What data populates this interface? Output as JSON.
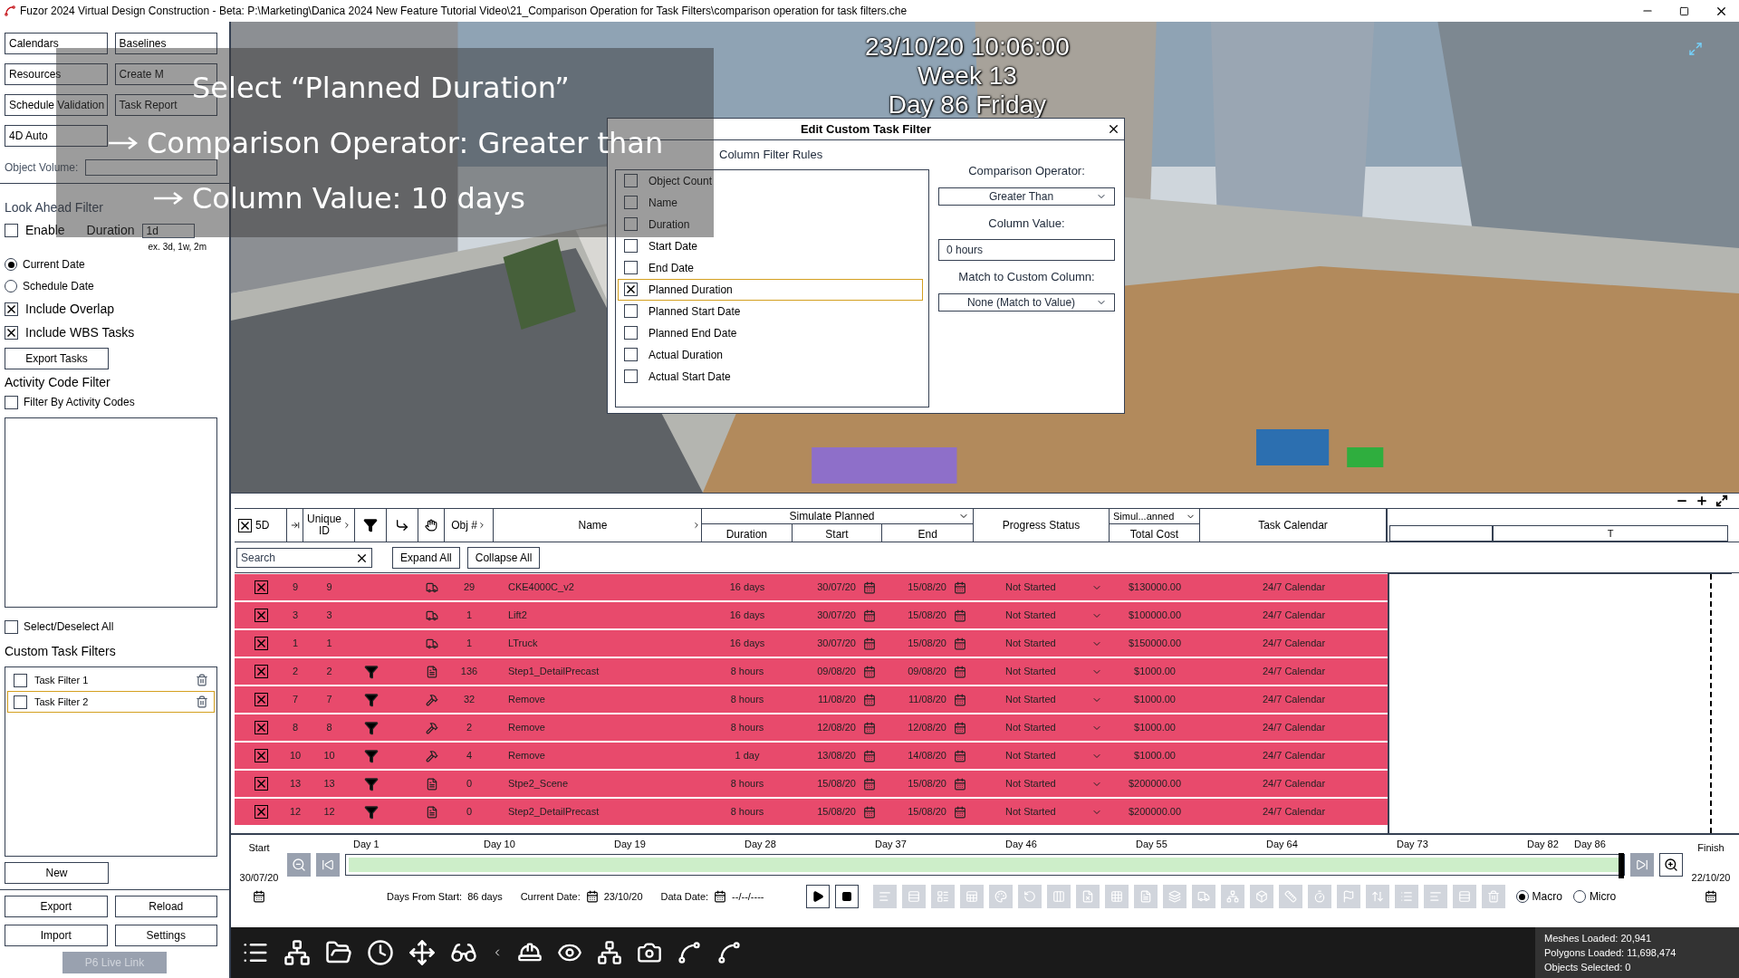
{
  "window": {
    "title": "Fuzor 2024 Virtual Design Construction - Beta: P:\\Marketing\\Danica 2024 New Feature Tutorial Video\\21_Comparison Operation for Task Filters\\comparison operation for task filters.che"
  },
  "left_panel": {
    "buttons": [
      "Calendars",
      "Baselines",
      "Resources",
      "Create M",
      "Schedule Validation",
      "Task Report",
      "4D Auto"
    ],
    "object_volume_label": "Object Volume:",
    "look_ahead": {
      "heading": "Look Ahead Filter",
      "enable": {
        "label": "Enable",
        "checked": false
      },
      "duration_label": "Duration",
      "duration_value": "1d",
      "hint": "ex. 3d, 1w, 2m"
    },
    "radios": [
      {
        "label": "Current Date",
        "selected": true
      },
      {
        "label": "Schedule Date",
        "selected": false
      }
    ],
    "checks": [
      {
        "label": "Include Overlap",
        "checked": true
      },
      {
        "label": "Include WBS Tasks",
        "checked": true
      }
    ],
    "export_tasks": "Export Tasks",
    "activity_heading": "Activity Code Filter",
    "activity_check": {
      "label": "Filter By Activity Codes",
      "checked": false
    },
    "select_all": {
      "label": "Select/Deselect All",
      "checked": false
    },
    "custom_heading": "Custom Task Filters",
    "custom_filters": [
      {
        "label": "Task Filter 1",
        "checked": false,
        "selected": false
      },
      {
        "label": "Task Filter 2",
        "checked": false,
        "selected": true
      }
    ],
    "new_button": "New",
    "bottom_buttons": [
      "Export",
      "Reload",
      "Import",
      "Settings"
    ],
    "live_link": {
      "label": "P6 Live Link",
      "disabled": true
    }
  },
  "view": {
    "clock": [
      "23/10/20 10:06:00",
      "Week 13",
      "Day 86 Friday"
    ]
  },
  "tutorial": [
    {
      "text": "Select “Planned Duration”",
      "arrow": false
    },
    {
      "text": "Comparison Operator: Greater than",
      "arrow": true
    },
    {
      "text": "Column Value: 10 days",
      "arrow": true
    }
  ],
  "dialog": {
    "title": "Edit Custom Task Filter",
    "section": "Column Filter Rules",
    "rules": [
      {
        "label": "Object Count",
        "checked": false,
        "selected": false
      },
      {
        "label": "Name",
        "checked": false,
        "selected": false
      },
      {
        "label": "Duration",
        "checked": false,
        "selected": false
      },
      {
        "label": "Start Date",
        "checked": false,
        "selected": false
      },
      {
        "label": "End Date",
        "checked": false,
        "selected": false
      },
      {
        "label": "Planned Duration",
        "checked": true,
        "selected": true
      },
      {
        "label": "Planned Start Date",
        "checked": false,
        "selected": false
      },
      {
        "label": "Planned End Date",
        "checked": false,
        "selected": false
      },
      {
        "label": "Actual Duration",
        "checked": false,
        "selected": false
      },
      {
        "label": "Actual Start Date",
        "checked": false,
        "selected": false
      }
    ],
    "operator_label": "Comparison Operator:",
    "operator": "Greater Than",
    "value_label": "Column Value:",
    "value": "0 hours",
    "match_label": "Match to Custom Column:",
    "match": "None (Match to Value)"
  },
  "table": {
    "select_all_checked": true,
    "header": {
      "five_d": "5D",
      "unique_id": "Unique ID",
      "obj": "Obj #",
      "name": "Name",
      "simulate": "Simulate Planned",
      "duration": "Duration",
      "start": "Start",
      "end": "End",
      "progress": "Progress Status",
      "cost_mode": "Simul...anned",
      "cost": "Total Cost",
      "calendar": "Task Calendar",
      "chart_col": "T"
    },
    "search_placeholder": "Search",
    "expand": "Expand All",
    "collapse": "Collapse All",
    "rows": [
      {
        "checked": true,
        "id": "9",
        "uid": "9",
        "filtered": false,
        "kind": "vehicle",
        "obj": "29",
        "name": "CKE4000C_v2",
        "duration": "16 days",
        "start": "30/07/20",
        "end": "15/08/20",
        "status": "Not Started",
        "cost": "$130000.00",
        "calendar": "24/7 Calendar"
      },
      {
        "checked": true,
        "id": "3",
        "uid": "3",
        "filtered": false,
        "kind": "vehicle",
        "obj": "1",
        "name": "Lift2",
        "duration": "16 days",
        "start": "30/07/20",
        "end": "15/08/20",
        "status": "Not Started",
        "cost": "$100000.00",
        "calendar": "24/7 Calendar"
      },
      {
        "checked": true,
        "id": "1",
        "uid": "1",
        "filtered": false,
        "kind": "vehicle",
        "obj": "1",
        "name": "LTruck",
        "duration": "16 days",
        "start": "30/07/20",
        "end": "15/08/20",
        "status": "Not Started",
        "cost": "$150000.00",
        "calendar": "24/7 Calendar"
      },
      {
        "checked": true,
        "id": "2",
        "uid": "2",
        "filtered": true,
        "kind": "document",
        "obj": "136",
        "name": "Step1_DetailPrecast",
        "duration": "8 hours",
        "start": "09/08/20",
        "end": "09/08/20",
        "status": "Not Started",
        "cost": "$1000.00",
        "calendar": "24/7 Calendar"
      },
      {
        "checked": true,
        "id": "7",
        "uid": "7",
        "filtered": true,
        "kind": "remove",
        "obj": "32",
        "name": "Remove",
        "duration": "8 hours",
        "start": "11/08/20",
        "end": "11/08/20",
        "status": "Not Started",
        "cost": "$1000.00",
        "calendar": "24/7 Calendar"
      },
      {
        "checked": true,
        "id": "8",
        "uid": "8",
        "filtered": true,
        "kind": "remove",
        "obj": "2",
        "name": "Remove",
        "duration": "8 hours",
        "start": "12/08/20",
        "end": "12/08/20",
        "status": "Not Started",
        "cost": "$1000.00",
        "calendar": "24/7 Calendar"
      },
      {
        "checked": true,
        "id": "10",
        "uid": "10",
        "filtered": true,
        "kind": "remove",
        "obj": "4",
        "name": "Remove",
        "duration": "1 day",
        "start": "13/08/20",
        "end": "14/08/20",
        "status": "Not Started",
        "cost": "$1000.00",
        "calendar": "24/7 Calendar"
      },
      {
        "checked": true,
        "id": "13",
        "uid": "13",
        "filtered": true,
        "kind": "document",
        "obj": "0",
        "name": "Stpe2_Scene",
        "duration": "8 hours",
        "start": "15/08/20",
        "end": "15/08/20",
        "status": "Not Started",
        "cost": "$200000.00",
        "calendar": "24/7 Calendar"
      },
      {
        "checked": true,
        "id": "12",
        "uid": "12",
        "filtered": true,
        "kind": "document",
        "obj": "0",
        "name": "Step2_DetailPrecast",
        "duration": "8 hours",
        "start": "15/08/20",
        "end": "15/08/20",
        "status": "Not Started",
        "cost": "$200000.00",
        "calendar": "24/7 Calendar"
      }
    ]
  },
  "timeline": {
    "start_label": "Start",
    "start_date": "30/07/20",
    "finish_label": "Finish",
    "finish_date": "22/10/20",
    "days": [
      "Day 1",
      "Day 10",
      "Day 19",
      "Day 28",
      "Day 37",
      "Day 46",
      "Day 55",
      "Day 64",
      "Day 73",
      "Day 82",
      "Day 86"
    ],
    "level": 1,
    "days_from_start_label": "Days From Start:",
    "days_from_start": "86 days",
    "current_date_label": "Current Date:",
    "current_date": "23/10/20",
    "data_date_label": "Data Date:",
    "data_date": "--/--/----",
    "modes": [
      {
        "label": "Macro",
        "selected": true
      },
      {
        "label": "Micro",
        "selected": false
      }
    ]
  },
  "status": [
    "Meshes Loaded: 20,941",
    "Polygons Loaded: 11,698,474",
    "Objects Selected: 0"
  ]
}
